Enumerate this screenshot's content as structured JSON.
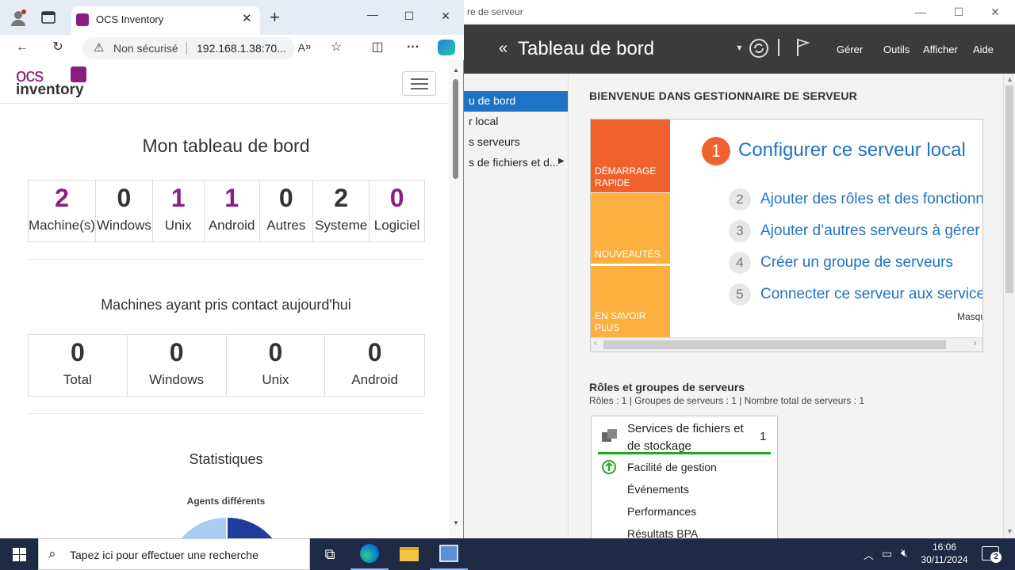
{
  "server_manager": {
    "window_title": "re de serveur",
    "header_title": "Tableau de bord",
    "menus": [
      "Gérer",
      "Outils",
      "Afficher",
      "Aide"
    ],
    "nav": [
      "u de bord",
      "r local",
      "s serveurs",
      "s de fichiers et d..."
    ],
    "welcome": "BIENVENUE DANS GESTIONNAIRE DE SERVEUR",
    "tiles": [
      "DÉMARRAGE RAPIDE",
      "NOUVEAUTÉS",
      "EN SAVOIR PLUS"
    ],
    "steps": [
      {
        "n": "1",
        "label": "Configurer ce serveur local"
      },
      {
        "n": "2",
        "label": "Ajouter des rôles et des fonctionnali"
      },
      {
        "n": "3",
        "label": "Ajouter d’autres serveurs à gérer"
      },
      {
        "n": "4",
        "label": "Créer un groupe de serveurs"
      },
      {
        "n": "5",
        "label": "Connecter ce serveur aux services c"
      }
    ],
    "hide_label": "Masqu",
    "roles_heading": "Rôles et groupes de serveurs",
    "roles_summary": "Rôles : 1   |   Groupes de serveurs : 1   |   Nombre total de serveurs : 1",
    "card": {
      "title_line1": "Services de fichiers et",
      "title_line2": "de stockage",
      "count": "1",
      "rows": [
        "Facilité de gestion",
        "Événements",
        "Performances",
        "Résultats BPA"
      ]
    },
    "colors": {
      "header": "#3b3b3b",
      "selected": "#1e73c4",
      "tile_orange": "#f0622d",
      "tile_yellow": "#fbb040",
      "ok_green": "#1cad1c"
    }
  },
  "browser": {
    "tab_title": "OCS Inventory",
    "security_label": "Non sécurisé",
    "url": "192.168.1.38:70...",
    "page": {
      "brand_top": "ocs",
      "brand_bottom": "inventory",
      "title": "Mon tableau de bord",
      "counters": [
        {
          "value": "2",
          "label": "Machine(s)",
          "accent": "purple"
        },
        {
          "value": "0",
          "label": "Windows",
          "accent": "dark"
        },
        {
          "value": "1",
          "label": "Unix",
          "accent": "purple"
        },
        {
          "value": "1",
          "label": "Android",
          "accent": "purple"
        },
        {
          "value": "0",
          "label": "Autres",
          "accent": "dark"
        },
        {
          "value": "2",
          "label": "Systeme",
          "accent": "dark"
        },
        {
          "value": "0",
          "label": "Logiciel",
          "accent": "purple"
        }
      ],
      "today_title": "Machines ayant pris contact aujourd'hui",
      "today": [
        {
          "value": "0",
          "label": "Total"
        },
        {
          "value": "0",
          "label": "Windows"
        },
        {
          "value": "0",
          "label": "Unix"
        },
        {
          "value": "0",
          "label": "Android"
        }
      ],
      "stats_title": "Statistiques",
      "stats_subtitle": "Agents différents"
    }
  },
  "taskbar": {
    "search_placeholder": "Tapez ici pour effectuer une recherche",
    "time": "16:06",
    "date": "30/11/2024",
    "notifications": "2"
  }
}
